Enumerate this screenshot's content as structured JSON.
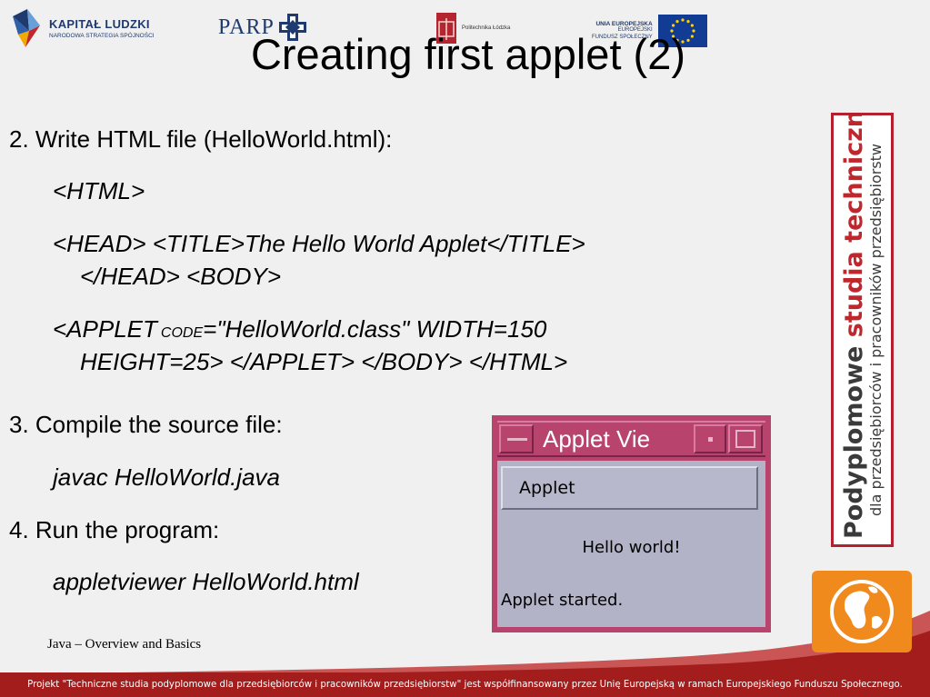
{
  "header": {
    "kl_title": "KAPITAŁ LUDZKI",
    "kl_subtitle": "NARODOWA STRATEGIA SPÓJNOŚCI",
    "parp": "PARP",
    "pl_text": "Politechnika Łódzka",
    "ue_line1": "UNIA EUROPEJSKA",
    "ue_line2": "EUROPEJSKI",
    "ue_line3": "FUNDUSZ SPOŁECZNY"
  },
  "slide": {
    "title": "Creating first applet (2)",
    "step2": "2. Write HTML file (HelloWorld.html):",
    "code_html": "<HTML>",
    "code_head_1": "<HEAD> <TITLE>The Hello World Applet</TITLE>",
    "code_head_2": "</HEAD> <BODY>",
    "code_applet_1a": "<APPLET",
    "code_applet_1b": "CODE",
    "code_applet_1c": "=\"HelloWorld.class\" WIDTH=150",
    "code_applet_2": "HEIGHT=25> </APPLET> </BODY> </HTML>",
    "step3": "3. Compile the source file:",
    "cmd_javac": "javac HelloWorld.java",
    "step4": "4. Run the program:",
    "cmd_viewer": "appletviewer HelloWorld.html",
    "footnote": "Java – Overview and Basics"
  },
  "applet_window": {
    "title": "Applet Vie",
    "menu_label": "Applet",
    "content": "Hello world!",
    "status": "Applet started."
  },
  "side_badge": {
    "line1_a": "Podyplomowe ",
    "line1_b": "studia",
    "line1_c": " techniczne",
    "line2": "dla przedsiębiorców i pracowników przedsiębiorstw"
  },
  "footer": {
    "banner": "Projekt \"Techniczne studia podyplomowe dla przedsiębiorców i pracowników przedsiębiorstw\" jest współfinansowany przez Unię Europejską w ramach Europejskiego Funduszu Społecznego."
  },
  "colors": {
    "banner_red": "#a31d1d",
    "window_pink": "#b8446e",
    "accent_red": "#c0272d",
    "globe_orange": "#f08a1d"
  }
}
